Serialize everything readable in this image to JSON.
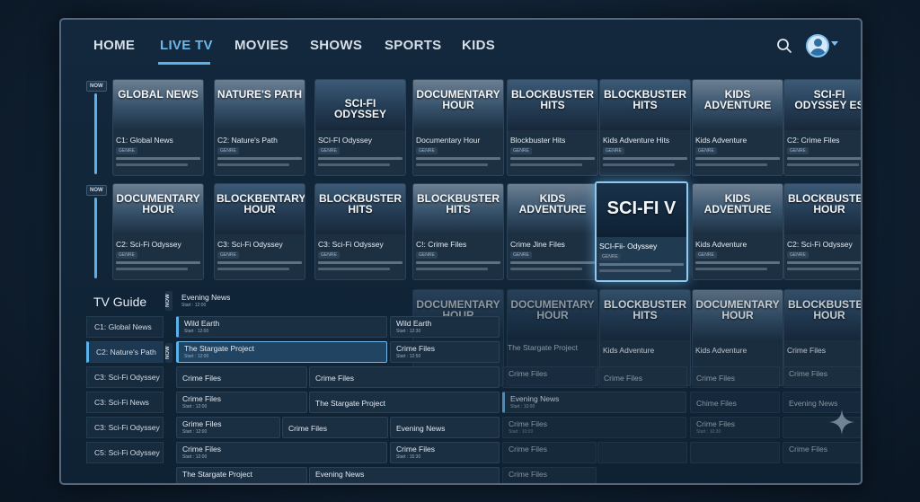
{
  "nav": {
    "items": [
      "HOME",
      "LIVE TV",
      "MOVIES",
      "SHOWS",
      "SPORTS",
      "KIDS"
    ],
    "active": "LIVE TV",
    "accent": "#5ab0e8"
  },
  "rows": [
    {
      "badge": "NOW",
      "cards": [
        {
          "thumb_title": "Global News",
          "name": "C1: Global News",
          "tag": "GENRE"
        },
        {
          "thumb_title": "Nature's Path",
          "name": "C2: Nature's Path",
          "tag": "GENRE"
        },
        {
          "thumb_title": "Sci-Fi Odyssey",
          "name": "SCI-FI Odyssey",
          "tag": "GENRE"
        },
        {
          "thumb_title": "Documentary Hour",
          "name": "Documentary Hour",
          "tag": "GENRE"
        },
        {
          "thumb_title": "Blockbuster Hits",
          "name": "Blockbuster Hits",
          "tag": "GENRE"
        },
        {
          "thumb_title": "Blockbuster Hits",
          "name": "Kids Adventure Hits",
          "tag": "GENRE"
        },
        {
          "thumb_title": "Kids Adventure",
          "name": "Kids Adventure",
          "tag": "GENRE"
        },
        {
          "thumb_title": "SCI-FI ODYSSEY ES",
          "name": "C2: Crime Files",
          "tag": "GENRE"
        }
      ]
    },
    {
      "badge": "NOW",
      "cards": [
        {
          "thumb_title": "Documentary Hour",
          "name": "C2: Sci-Fi Odyssey",
          "tag": "GENRE"
        },
        {
          "thumb_title": "Blockbentary Hour",
          "name": "C3: Sci-Fi Odyssey",
          "tag": "GENRE"
        },
        {
          "thumb_title": "Blockbuster Hits",
          "name": "C3: Sci-Fi Odyssey",
          "tag": "GENRE"
        },
        {
          "thumb_title": "Blockbuster Hits",
          "name": "C!: Crime Files",
          "tag": "GENRE"
        },
        {
          "thumb_title": "Kids Adventure",
          "name": "Crime Jine Files",
          "tag": "GENRE"
        },
        {
          "thumb_title": "SCI-FI V",
          "name": "SCI-Fii- Odyssey",
          "tag": "GENRE",
          "focused": true
        },
        {
          "thumb_title": "Kids Adventure",
          "name": "Kids Adventure",
          "tag": "GENRE"
        },
        {
          "thumb_title": "Blockbuster Hour",
          "name": "C2: Sci-Fi Odyssey",
          "tag": "GENRE"
        }
      ]
    }
  ],
  "guide": {
    "title": "TV Guide",
    "now_label": "NOW",
    "channels": [
      "C1: Global News",
      "C2: Nature's Path",
      "C3: Sci-Fi Odyssey",
      "C3: Sci-Fi News",
      "C3: Sci-Fi Odyssey",
      "C5: Sci-Fi Odyssey"
    ],
    "top_program": {
      "title": "Evening News",
      "start": "Start : 12:00"
    },
    "programs": [
      {
        "title": "Wild Earth",
        "start": "Start : 12:00"
      },
      {
        "title": "Wild Earth",
        "start": "Start : 12:30"
      },
      {
        "title": "The Stargate Project",
        "start": "Start : 12:00"
      },
      {
        "title": "Crime Files",
        "start": "Start : 12:50"
      },
      {
        "title": "Crime Files",
        "start": ""
      },
      {
        "title": "Crime Files",
        "start": ""
      },
      {
        "title": "Crime Files",
        "start": "Start : 12:00"
      },
      {
        "title": "The Stargate Project",
        "start": ""
      },
      {
        "title": "Grime Files",
        "start": "Start : 12:00"
      },
      {
        "title": "Crime Files",
        "start": ""
      },
      {
        "title": "Evening News",
        "start": ""
      },
      {
        "title": "Crime Files",
        "start": "Start : 12:00"
      },
      {
        "title": "Crime Files",
        "start": "Start : 15:30"
      },
      {
        "title": "The Stargate Project",
        "start": ""
      },
      {
        "title": "Evening News",
        "start": ""
      }
    ],
    "faded_cards": [
      {
        "thumb_title": "Documentary Hour"
      },
      {
        "thumb_title": "Documentary Hour"
      },
      {
        "thumb_title": "Blockbuster Hits",
        "name": "Kids Adventure"
      },
      {
        "thumb_title": "Documentary Hour",
        "name": "Kids Adventure"
      },
      {
        "thumb_title": "Blockbuster Hour",
        "name": "Crime Files"
      }
    ],
    "faded_programs": [
      {
        "title": "The Stargate Project"
      },
      {
        "title": "Crime Files"
      },
      {
        "title": "Crime Files"
      },
      {
        "title": "Crime Files"
      },
      {
        "title": "Crime Files"
      },
      {
        "title": "Evening News",
        "start": "Start : 10:00"
      },
      {
        "title": "Chime Files"
      },
      {
        "title": "Evening News"
      },
      {
        "title": "Crime Files",
        "start": "Start : 10:00"
      },
      {
        "title": "Crime Files",
        "start": "Start : 10:30"
      },
      {
        "title": "Crime Files"
      },
      {
        "title": "Crime Files"
      },
      {
        "title": "Crime Files"
      },
      {
        "title": "Crime Files"
      },
      {
        "title": "Crime Files"
      },
      {
        "title": "Crime Files"
      }
    ]
  }
}
